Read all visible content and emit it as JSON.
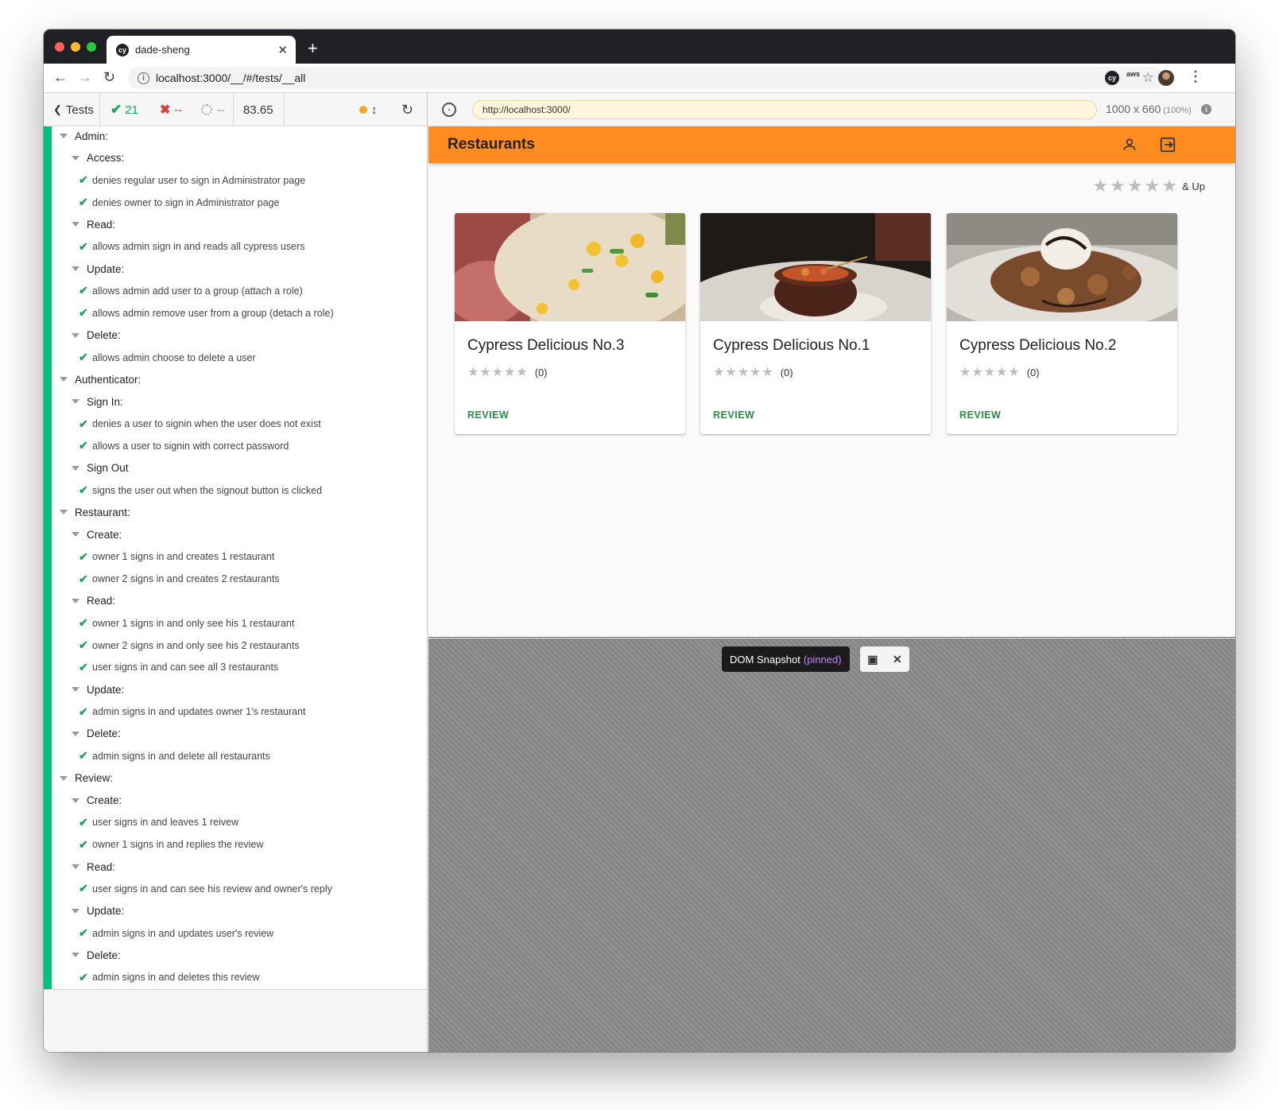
{
  "browser": {
    "tab_title": "dade-sheng",
    "tab_favicon": "cy",
    "url": "localhost:3000/__/#/tests/__all",
    "traffic_lights": [
      "#ff5f57",
      "#febc2e",
      "#28c840"
    ]
  },
  "reporter_header": {
    "tests_label": "Tests",
    "passed": "21",
    "failed": "--",
    "pending": "--",
    "duration": "83.65"
  },
  "runner": {
    "aut_url": "http://localhost:3000/",
    "viewport": "1000 x 660",
    "scale": "(100%)",
    "snapshot_label": "DOM Snapshot",
    "snapshot_pinned": "(pinned)"
  },
  "tree": [
    {
      "type": "suite",
      "level": 0,
      "label": "Admin:"
    },
    {
      "type": "suite",
      "level": 1,
      "label": "Access:"
    },
    {
      "type": "test",
      "label": "denies regular user to sign in Administrator page"
    },
    {
      "type": "test",
      "label": "denies owner to sign in Administrator page"
    },
    {
      "type": "suite",
      "level": 1,
      "label": "Read:"
    },
    {
      "type": "test",
      "label": "allows admin sign in and reads all cypress users"
    },
    {
      "type": "suite",
      "level": 1,
      "label": "Update:"
    },
    {
      "type": "test",
      "label": "allows admin add user to a group (attach a role)"
    },
    {
      "type": "test",
      "label": "allows admin remove user from a group (detach a role)"
    },
    {
      "type": "suite",
      "level": 1,
      "label": "Delete:"
    },
    {
      "type": "test",
      "label": "allows admin choose to delete a user"
    },
    {
      "type": "suite",
      "level": 0,
      "label": "Authenticator:"
    },
    {
      "type": "suite",
      "level": 1,
      "label": "Sign In:"
    },
    {
      "type": "test",
      "label": "denies a user to signin when the user does not exist"
    },
    {
      "type": "test",
      "label": "allows a user to signin with correct password"
    },
    {
      "type": "suite",
      "level": 1,
      "label": "Sign Out"
    },
    {
      "type": "test",
      "label": "signs the user out when the signout button is clicked"
    },
    {
      "type": "suite",
      "level": 0,
      "label": "Restaurant:"
    },
    {
      "type": "suite",
      "level": 1,
      "label": "Create:"
    },
    {
      "type": "test",
      "label": "owner 1 signs in and creates 1 restaurant"
    },
    {
      "type": "test",
      "label": "owner 2 signs in and creates 2 restaurants"
    },
    {
      "type": "suite",
      "level": 1,
      "label": "Read:"
    },
    {
      "type": "test",
      "label": "owner 1 signs in and only see his 1 restaurant"
    },
    {
      "type": "test",
      "label": "owner 2 signs in and only see his 2 restaurants"
    },
    {
      "type": "test",
      "label": "user signs in and can see all 3 restaurants"
    },
    {
      "type": "suite",
      "level": 1,
      "label": "Update:"
    },
    {
      "type": "test",
      "label": "admin signs in and updates owner 1's restaurant"
    },
    {
      "type": "suite",
      "level": 1,
      "label": "Delete:"
    },
    {
      "type": "test",
      "label": "admin signs in and delete all restaurants"
    },
    {
      "type": "suite",
      "level": 0,
      "label": "Review:"
    },
    {
      "type": "suite",
      "level": 1,
      "label": "Create:"
    },
    {
      "type": "test",
      "label": "user signs in and leaves 1 reivew"
    },
    {
      "type": "test",
      "label": "owner 1 signs in and replies the review"
    },
    {
      "type": "suite",
      "level": 1,
      "label": "Read:"
    },
    {
      "type": "test",
      "label": "user signs in and can see his review and owner's reply"
    },
    {
      "type": "suite",
      "level": 1,
      "label": "Update:"
    },
    {
      "type": "test",
      "label": "admin signs in and updates user's review"
    },
    {
      "type": "suite",
      "level": 1,
      "label": "Delete:"
    },
    {
      "type": "test",
      "label": "admin signs in and deletes this review"
    }
  ],
  "app": {
    "title": "Restaurants",
    "accent": "#ff8c21",
    "filter_label": "& Up",
    "filter_stars": 5,
    "cards": [
      {
        "name": "Cypress Delicious No.3",
        "count": "(0)",
        "action": "REVIEW",
        "rating": 0,
        "image": "fried-rice"
      },
      {
        "name": "Cypress Delicious No.1",
        "count": "(0)",
        "action": "REVIEW",
        "rating": 0,
        "image": "clay-pot-stew"
      },
      {
        "name": "Cypress Delicious No.2",
        "count": "(0)",
        "action": "REVIEW",
        "rating": 0,
        "image": "dessert-plate"
      }
    ]
  }
}
